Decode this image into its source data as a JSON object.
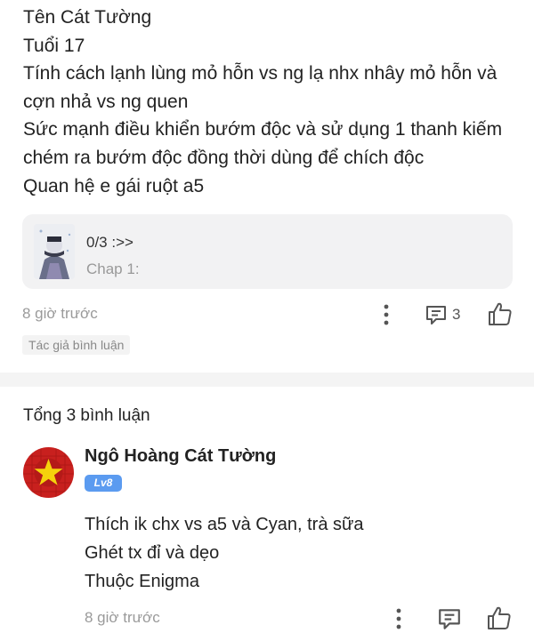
{
  "post": {
    "lines": [
      "Tên Cát Tường",
      "Tuổi 17",
      "Tính cách lạnh lùng mỏ hỗn vs ng lạ nhx nhây mỏ hỗn và",
      "cợn nhả vs ng quen",
      "Sức mạnh điều khiển bướm độc và sử dụng 1 thanh kiếm",
      "chém ra bướm độc đồng thời dùng để chích độc",
      "Quan hệ e gái ruột a5"
    ],
    "chapter_card": {
      "progress": "0/3 :>>",
      "title": "Chap 1:"
    },
    "time": "8 giờ trước",
    "comment_count": "3",
    "author_tag": "Tác giả bình luận"
  },
  "comments_header": "Tổng 3 bình luận",
  "comment": {
    "name": "Ngô Hoàng Cát Tường",
    "level": "Lv8",
    "lines": [
      "Thích ik chx vs a5 và Cyan, trà sữa",
      "Ghét tx đỉ và dẹo",
      "Thuộc Enigma"
    ],
    "time": "8 giờ trước"
  },
  "icons": {
    "more": "more-vertical-icon",
    "comment": "comment-icon",
    "like": "thumbs-up-icon"
  },
  "colors": {
    "badge": "#5b9bf0",
    "avatar_red": "#c8201e",
    "avatar_star": "#f5d20c",
    "muted_text": "#9a9a9a"
  }
}
